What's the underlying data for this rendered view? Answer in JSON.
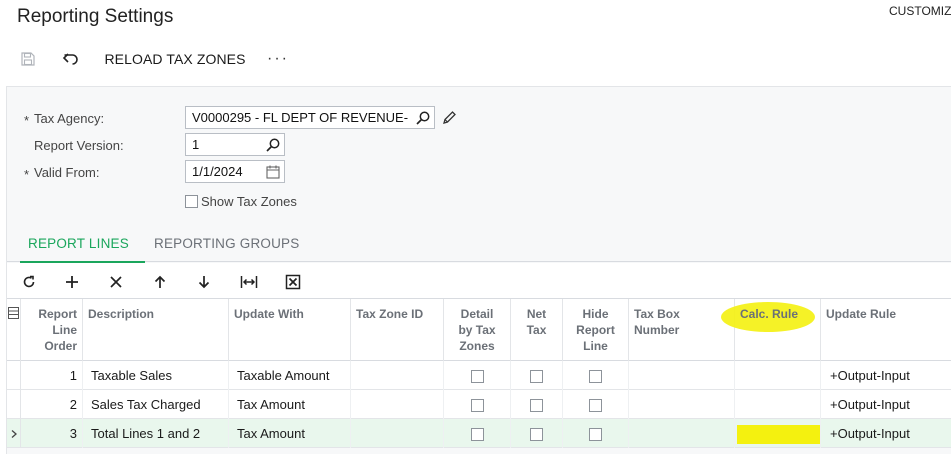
{
  "header": {
    "title": "Reporting Settings",
    "customize": "CUSTOMIZ"
  },
  "toolbar": {
    "reload_label": "RELOAD TAX ZONES",
    "more_label": "···"
  },
  "form": {
    "tax_agency": {
      "label": "Tax Agency:",
      "value": "V0000295 - FL DEPT OF REVENUE-",
      "required": "*"
    },
    "report_version": {
      "label": "Report Version:",
      "value": "1"
    },
    "valid_from": {
      "label": "Valid From:",
      "value": "1/1/2024",
      "required": "*"
    },
    "show_tax_zones": {
      "label": "Show Tax Zones",
      "checked": false
    }
  },
  "tabs": [
    {
      "label": "REPORT LINES",
      "active": true
    },
    {
      "label": "REPORTING GROUPS",
      "active": false
    }
  ],
  "grid": {
    "columns": [
      "Report Line Order",
      "Description",
      "Update With",
      "Tax Zone ID",
      "Detail by Tax Zones",
      "Net Tax",
      "Hide Report Line",
      "Tax Box Number",
      "Calc. Rule",
      "Update Rule"
    ],
    "header_lines": {
      "order": [
        "Report",
        "Line",
        "Order"
      ],
      "detail": [
        "Detail",
        "by Tax",
        "Zones"
      ],
      "net": [
        "Net",
        "Tax"
      ],
      "hide": [
        "Hide",
        "Report",
        "Line"
      ],
      "taxbox": [
        "Tax Box",
        "Number"
      ]
    },
    "rows": [
      {
        "order": "1",
        "description": "Taxable Sales",
        "update_with": "Taxable Amount",
        "tax_zone_id": "",
        "update_rule": "+Output-Input",
        "active": false
      },
      {
        "order": "2",
        "description": "Sales Tax Charged",
        "update_with": "Tax Amount",
        "tax_zone_id": "",
        "update_rule": "+Output-Input",
        "active": false
      },
      {
        "order": "3",
        "description": "Total Lines 1 and 2",
        "update_with": "Tax Amount",
        "tax_zone_id": "",
        "update_rule": "+Output-Input",
        "active": true
      }
    ]
  },
  "colors": {
    "accent": "#1aa65c",
    "highlight": "#f4f10f",
    "active_row": "#e9f7ed"
  }
}
